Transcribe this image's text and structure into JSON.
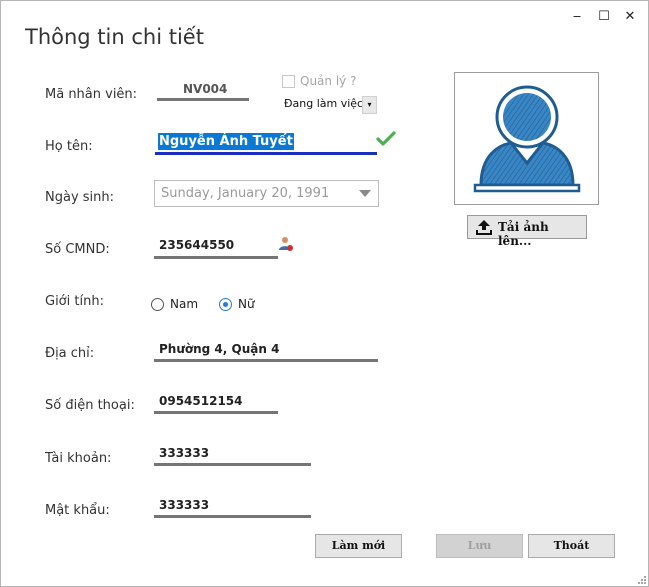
{
  "window": {
    "title": "Thông tin chi tiết",
    "minimize_glyph": "‒",
    "maximize_glyph": "☐",
    "close_glyph": "✕"
  },
  "form": {
    "ma_nhan_vien": {
      "label": "Mã nhân viên:",
      "value": "NV004"
    },
    "quan_ly": {
      "label": "Quản lý ?",
      "checked": false
    },
    "trang_thai": {
      "value": "Đang làm việc",
      "dropdown_glyph": "▾"
    },
    "ho_ten": {
      "label": "Họ tên:",
      "value": "Nguyễn Ánh Tuyết"
    },
    "ngay_sinh": {
      "label": "Ngày sinh:",
      "value": "Sunday, January 20, 1991"
    },
    "so_cmnd": {
      "label": "Số CMND:",
      "value": "235644550"
    },
    "gioi_tinh": {
      "label": "Giới tính:",
      "options": [
        "Nam",
        "Nữ"
      ],
      "selected": "Nữ"
    },
    "dia_chi": {
      "label": "Địa chỉ:",
      "value": "Phường 4, Quận 4"
    },
    "so_dien_thoai": {
      "label": "Số điện thoại:",
      "value": "0954512154"
    },
    "tai_khoan": {
      "label": "Tài khoản:",
      "value": "333333"
    },
    "mat_khau": {
      "label": "Mật khẩu:",
      "value": "333333"
    }
  },
  "avatar": {
    "upload_label": "Tải ảnh lên..."
  },
  "buttons": {
    "lam_moi": "Làm mới",
    "luu": "Lưu",
    "thoat": "Thoát"
  },
  "colors": {
    "selection": "#0a78d7",
    "active_underline": "#1a2fbf",
    "avatar_blue": "#2b7ab8",
    "check_green": "#4caf50",
    "radio_blue": "#2a7ad6"
  },
  "icons": {
    "valid": "check-icon",
    "id_card": "user-id-icon",
    "upload": "upload-icon",
    "avatar": "person-silhouette-icon"
  }
}
